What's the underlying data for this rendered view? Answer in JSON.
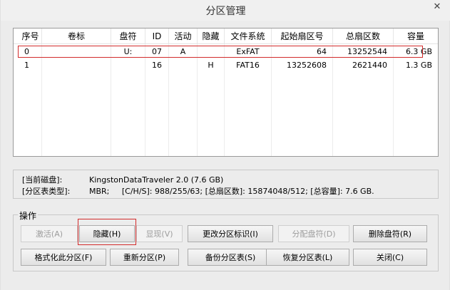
{
  "window": {
    "title": "分区管理",
    "close_glyph": "✕"
  },
  "table": {
    "columns": [
      "序号",
      "卷标",
      "盘符",
      "ID",
      "活动",
      "隐藏",
      "文件系统",
      "起始扇区号",
      "总扇区数",
      "容量"
    ],
    "rows": [
      {
        "index": "0",
        "label": "",
        "drive": "U:",
        "id": "07",
        "active": "A",
        "hidden": "",
        "fs": "ExFAT",
        "start": "64",
        "total": "13252544",
        "size": "6.3 GB"
      },
      {
        "index": "1",
        "label": "",
        "drive": "",
        "id": "16",
        "active": "",
        "hidden": "H",
        "fs": "FAT16",
        "start": "13252608",
        "total": "2621440",
        "size": "1.3 GB"
      }
    ]
  },
  "disk_info": {
    "current_disk_label": "[当前磁盘]:",
    "current_disk_value": "KingstonDataTraveler 2.0 (7.6 GB)",
    "table_type_label": "[分区表类型]:",
    "table_type_value": "MBR;     [C/H/S]: 988/255/63; [总扇区数]: 15874048/512; [总容量]: 7.6 GB."
  },
  "operations": {
    "legend": "操作",
    "row1": [
      {
        "key": "activate",
        "label": "激活(A)",
        "enabled": false
      },
      {
        "key": "hide",
        "label": "隐藏(H)",
        "enabled": true
      },
      {
        "key": "show",
        "label": "显现(V)",
        "enabled": false
      },
      {
        "key": "change_id",
        "label": "更改分区标识(I)",
        "enabled": true
      },
      {
        "key": "assign_letter",
        "label": "分配盘符(D)",
        "enabled": false
      },
      {
        "key": "remove_letter",
        "label": "删除盘符(R)",
        "enabled": true
      }
    ],
    "row2": [
      {
        "key": "format",
        "label": "格式化此分区(F)",
        "enabled": true
      },
      {
        "key": "repartition",
        "label": "重新分区(P)",
        "enabled": true
      },
      {
        "key": "backup_table",
        "label": "备份分区表(S)",
        "enabled": true
      },
      {
        "key": "restore_table",
        "label": "恢复分区表(L)",
        "enabled": true
      },
      {
        "key": "close",
        "label": "关闭(C)",
        "enabled": true
      }
    ]
  }
}
